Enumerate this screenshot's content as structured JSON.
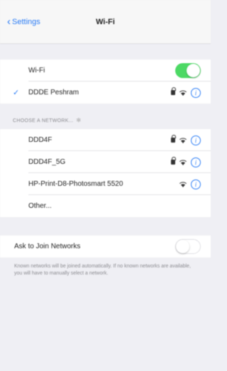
{
  "navbar": {
    "back_label": "Settings",
    "title": "Wi-Fi"
  },
  "wifi_row": {
    "label": "Wi-Fi",
    "toggle_state": "on"
  },
  "connected": {
    "name": "DDDE Peshram"
  },
  "networks_header": "CHOOSE A NETWORK...",
  "networks": [
    {
      "name": "DDD4F",
      "locked": true
    },
    {
      "name": "DDD4F_5G",
      "locked": true
    },
    {
      "name": "HP-Print-D8-Photosmart 5520",
      "locked": false
    },
    {
      "name": "Other...",
      "other": true
    }
  ],
  "ask_to_join": {
    "label": "Ask to Join Networks",
    "toggle_state": "off"
  },
  "footer": "Known networks will be joined automatically. If no known networks are available, you will have to manually select a network."
}
